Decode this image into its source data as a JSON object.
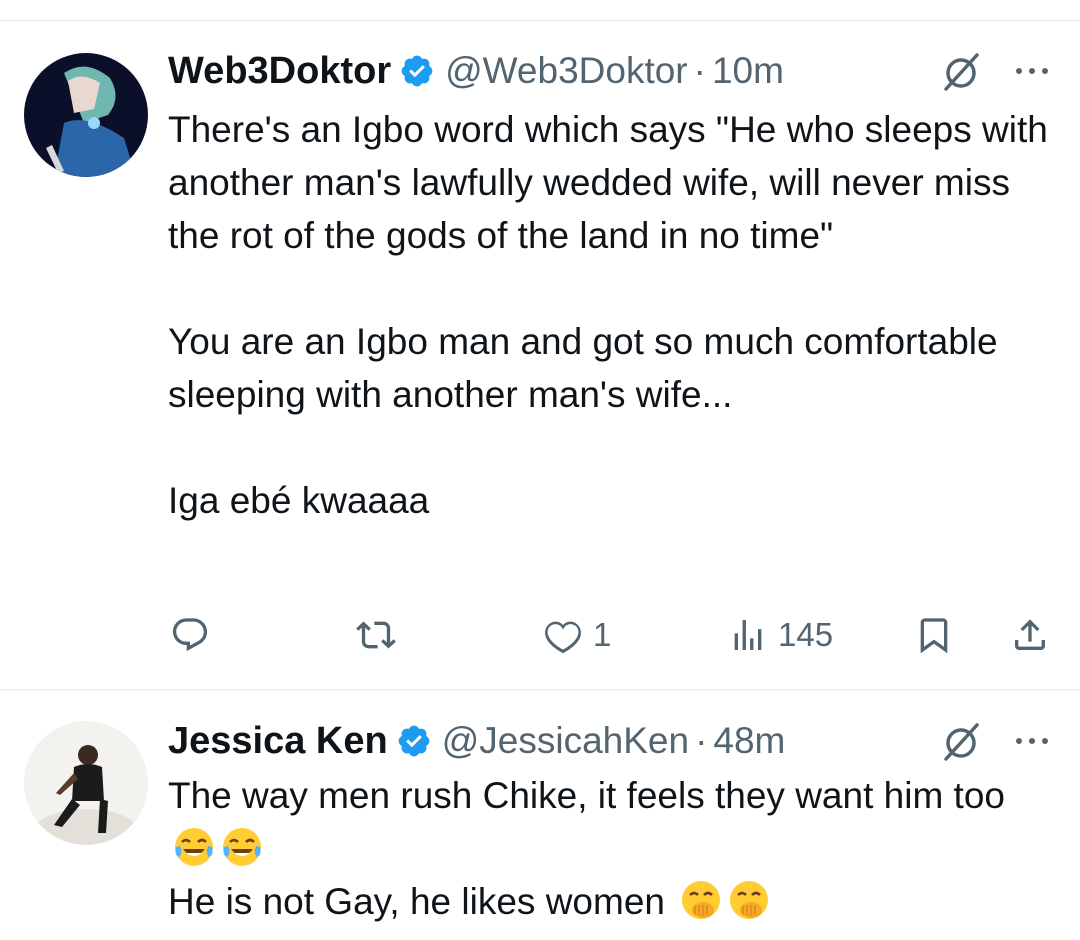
{
  "tweets": [
    {
      "author_name": "Web3Doktor",
      "handle": "@Web3Doktor",
      "separator": "·",
      "time": "10m",
      "paragraphs": [
        "There's an Igbo word which says \"He who sleeps with another man's lawfully wedded wife, will never miss the rot of the gods of the land in no time\"",
        "You are an Igbo man and got so much comfortable sleeping with another man's wife...",
        "Iga ebé kwaaaa"
      ],
      "actions": {
        "reply_count": "",
        "retweet_count": "",
        "like_count": "1",
        "views_count": "145"
      }
    },
    {
      "author_name": "Jessica Ken",
      "handle": "@JessicahKen",
      "separator": "·",
      "time": "48m",
      "line1": "The way men rush Chike, it feels they want him too",
      "line2": "He is not Gay, he likes women"
    }
  ],
  "icons": {
    "verified": "verified-badge-icon",
    "grok": "grok-icon",
    "more": "more-dots-icon",
    "reply": "reply-icon",
    "retweet": "retweet-icon",
    "like": "heart-icon",
    "views": "views-icon",
    "bookmark": "bookmark-icon",
    "share": "share-icon",
    "emoji_laugh": "tears-of-joy-emoji",
    "emoji_peek": "face-with-hand-over-mouth-emoji"
  },
  "colors": {
    "text": "#0f1419",
    "secondary": "#536471",
    "verified": "#1d9bf0",
    "divider": "#eff3f4"
  }
}
